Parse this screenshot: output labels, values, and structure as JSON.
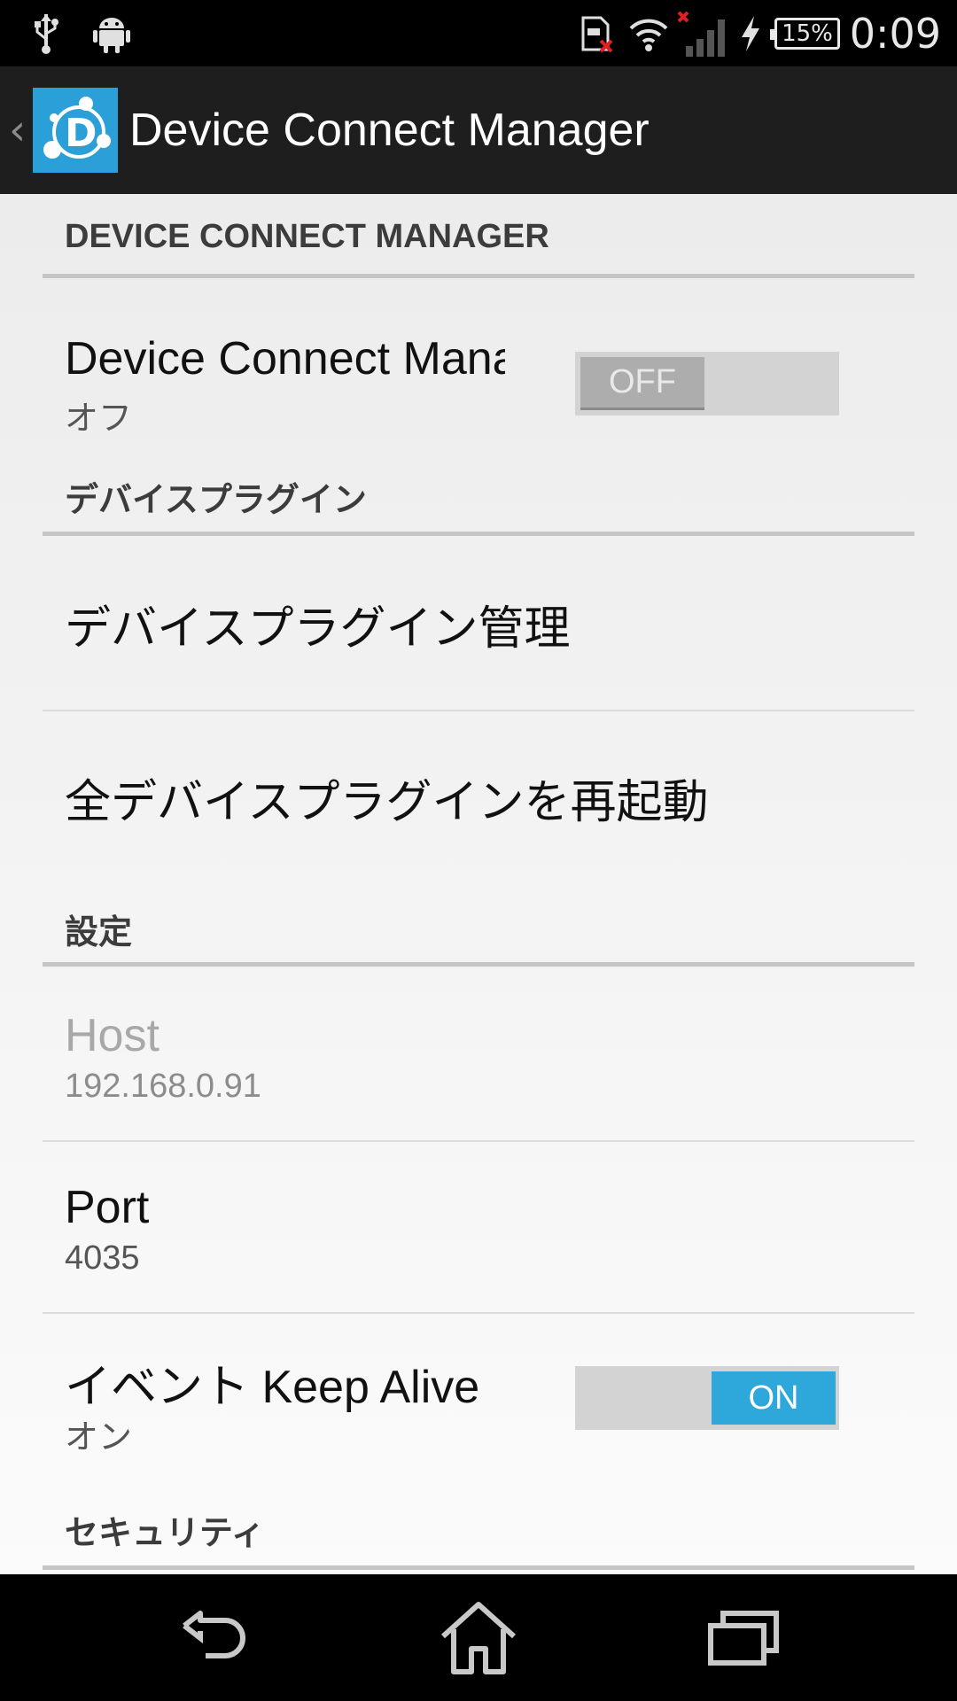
{
  "status_bar": {
    "battery_percent": "15%",
    "time": "0:09",
    "icons": [
      "usb-icon",
      "android-debug-icon",
      "sd-card-error-icon",
      "wifi-icon",
      "no-signal-icon",
      "charging-icon",
      "battery-icon"
    ]
  },
  "action_bar": {
    "title": "Device Connect Manager"
  },
  "sections": {
    "manager": {
      "header": "DEVICE CONNECT MANAGER",
      "toggle_title": "Device Connect Manager",
      "toggle_summary": "オフ",
      "toggle_label": "OFF",
      "toggle_checked": false
    },
    "plugins": {
      "header": "デバイスプラグイン",
      "manage": "デバイスプラグイン管理",
      "restart_all": "全デバイスプラグインを再起動"
    },
    "settings": {
      "header": "設定",
      "host_title": "Host",
      "host_value": "192.168.0.91",
      "port_title": "Port",
      "port_value": "4035",
      "keepalive_title": "イベント Keep Alive",
      "keepalive_summary": "オン",
      "keepalive_label": "ON",
      "keepalive_checked": true
    },
    "security": {
      "header": "セキュリティ"
    }
  },
  "colors": {
    "accent": "#2ea8da",
    "action_bar": "#1e1e1e",
    "app_icon": "#2a9fd8"
  }
}
